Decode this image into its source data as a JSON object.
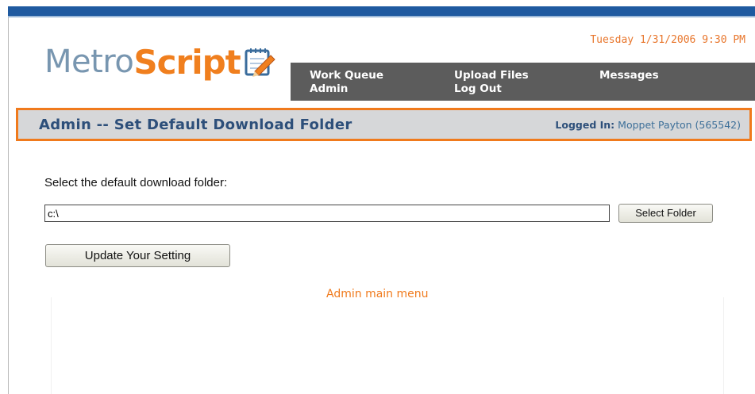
{
  "header": {
    "logo_part1": "Metro",
    "logo_part2": "Script",
    "datetime": "Tuesday 1/31/2006 9:30 PM"
  },
  "nav": {
    "work_queue": "Work Queue",
    "admin": "Admin",
    "upload_files": "Upload Files",
    "log_out": "Log Out",
    "messages": "Messages"
  },
  "title_bar": {
    "title": "Admin -- Set Default Download Folder",
    "logged_in_label": "Logged In:",
    "logged_in_user": "Moppet Payton (565542)"
  },
  "form": {
    "prompt": "Select the default download folder:",
    "folder_value": "c:\\",
    "select_folder_label": "Select Folder",
    "update_label": "Update Your Setting"
  },
  "links": {
    "admin_main_menu": "Admin main menu"
  },
  "colors": {
    "accent_orange": "#f07a1c",
    "brand_blue": "#1f5aa0",
    "nav_gray": "#5c5c5c"
  }
}
